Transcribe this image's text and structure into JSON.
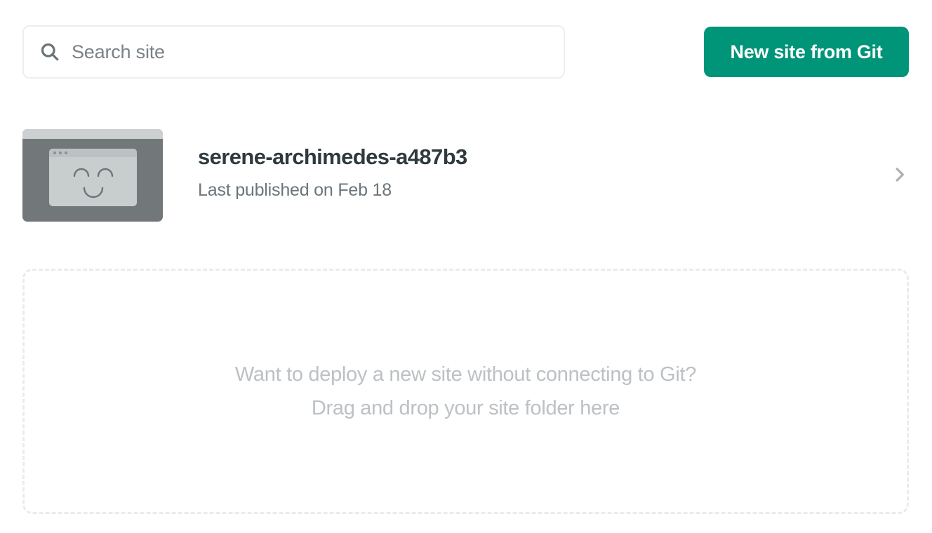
{
  "toolbar": {
    "search": {
      "placeholder": "Search site",
      "value": "",
      "icon": "search-icon"
    },
    "new_site_button": {
      "label": "New site from Git",
      "color": "#009478"
    }
  },
  "sites": [
    {
      "name": "serene-archimedes-a487b3",
      "meta": "Last published on Feb 18",
      "thumbnail_icon": "smiley-browser-window-icon",
      "chevron_icon": "chevron-right-icon"
    }
  ],
  "dropzone": {
    "line1": "Want to deploy a new site without connecting to Git?",
    "line2": "Drag and drop your site folder here"
  },
  "colors": {
    "accent": "#009478",
    "title_text": "#2f3a3f",
    "muted_text": "#6b757a",
    "placeholder_text": "#7a8287",
    "dropzone_text": "#bcc1c4",
    "dropzone_border": "#eaecec",
    "thumb_bg": "#72777a",
    "thumb_window": "#c8cdce"
  }
}
